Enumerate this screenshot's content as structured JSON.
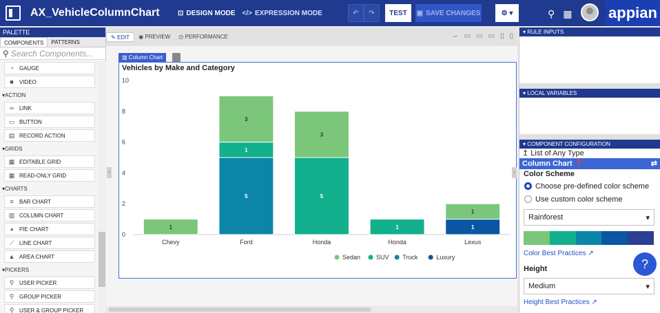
{
  "header": {
    "app_title": "AX_VehicleColumnChart",
    "design_mode": "DESIGN MODE",
    "expression_mode": "EXPRESSION MODE",
    "test_label": "TEST",
    "save_label": "SAVE CHANGES",
    "logo": "appian"
  },
  "palette": {
    "title": "PALETTE",
    "tabs": [
      "COMPONENTS",
      "PATTERNS"
    ],
    "search_placeholder": "Search Components...",
    "items": [
      {
        "kind": "item",
        "label": "GAUGE",
        "icon": "gauge-icon",
        "glyph": "◔"
      },
      {
        "kind": "item",
        "label": "VIDEO",
        "icon": "video-icon",
        "glyph": "■"
      },
      {
        "kind": "section",
        "label": "ACTION"
      },
      {
        "kind": "item",
        "label": "LINK",
        "icon": "link-icon",
        "glyph": "∞"
      },
      {
        "kind": "item",
        "label": "BUTTON",
        "icon": "button-icon",
        "glyph": "▭"
      },
      {
        "kind": "item",
        "label": "RECORD ACTION",
        "icon": "record-action-icon",
        "glyph": "▤"
      },
      {
        "kind": "section",
        "label": "GRIDS"
      },
      {
        "kind": "item",
        "label": "EDITABLE GRID",
        "icon": "editable-grid-icon",
        "glyph": "▦"
      },
      {
        "kind": "item",
        "label": "READ-ONLY GRID",
        "icon": "read-only-grid-icon",
        "glyph": "▦"
      },
      {
        "kind": "section",
        "label": "CHARTS"
      },
      {
        "kind": "item",
        "label": "BAR CHART",
        "icon": "bar-chart-icon",
        "glyph": "≡"
      },
      {
        "kind": "item",
        "label": "COLUMN CHART",
        "icon": "column-chart-icon",
        "glyph": "▥"
      },
      {
        "kind": "item",
        "label": "PIE CHART",
        "icon": "pie-chart-icon",
        "glyph": "◕"
      },
      {
        "kind": "item",
        "label": "LINE CHART",
        "icon": "line-chart-icon",
        "glyph": "⟋"
      },
      {
        "kind": "item",
        "label": "AREA CHART",
        "icon": "area-chart-icon",
        "glyph": "▲"
      },
      {
        "kind": "section",
        "label": "PICKERS"
      },
      {
        "kind": "item",
        "label": "USER PICKER",
        "icon": "user-picker-icon",
        "glyph": "⚲"
      },
      {
        "kind": "item",
        "label": "GROUP PICKER",
        "icon": "group-picker-icon",
        "glyph": "⚲"
      },
      {
        "kind": "item",
        "label": "USER & GROUP PICKER",
        "icon": "user-group-picker-icon",
        "glyph": "⚲"
      }
    ]
  },
  "canvas": {
    "tabs": [
      "EDIT",
      "PREVIEW",
      "PERFORMANCE"
    ],
    "component_tag": "Column Chart"
  },
  "chart_data": {
    "type": "bar",
    "stacked": true,
    "title": "Vehicles by Make and Category",
    "categories": [
      "Chevy",
      "Ford",
      "Honda",
      "Honda",
      "Lexus"
    ],
    "ylim": [
      0,
      10
    ],
    "yticks": [
      0,
      2,
      4,
      6,
      8,
      10
    ],
    "grid": false,
    "legend_position": "bottom-right",
    "series": [
      {
        "name": "Sedan",
        "color": "#7bc67b",
        "values": [
          1,
          3,
          3,
          0,
          1
        ]
      },
      {
        "name": "SUV",
        "color": "#12b08c",
        "values": [
          0,
          1,
          5,
          1,
          0
        ]
      },
      {
        "name": "Truck",
        "color": "#0c86a8",
        "values": [
          0,
          5,
          0,
          0,
          0
        ]
      },
      {
        "name": "Luxury",
        "color": "#0a56a3",
        "values": [
          0,
          0,
          0,
          0,
          1
        ]
      }
    ]
  },
  "right_panel": {
    "rule_inputs": "RULE INPUTS",
    "local_variables": "LOCAL VARIABLES",
    "component_configuration": "COMPONENT CONFIGURATION",
    "type_label": "List of Any Type",
    "component_name": "Column Chart",
    "color_scheme_label": "Color Scheme",
    "radio_predefined": "Choose pre-defined color scheme",
    "radio_custom": "Use custom color scheme",
    "scheme_value": "Rainforest",
    "scheme_colors": [
      "#7bc67b",
      "#12b08c",
      "#0c86a8",
      "#0a56a3",
      "#2b3e8f"
    ],
    "color_link": "Color Best Practices",
    "height_label": "Height",
    "height_value": "Medium",
    "height_link": "Height Best Practices"
  }
}
